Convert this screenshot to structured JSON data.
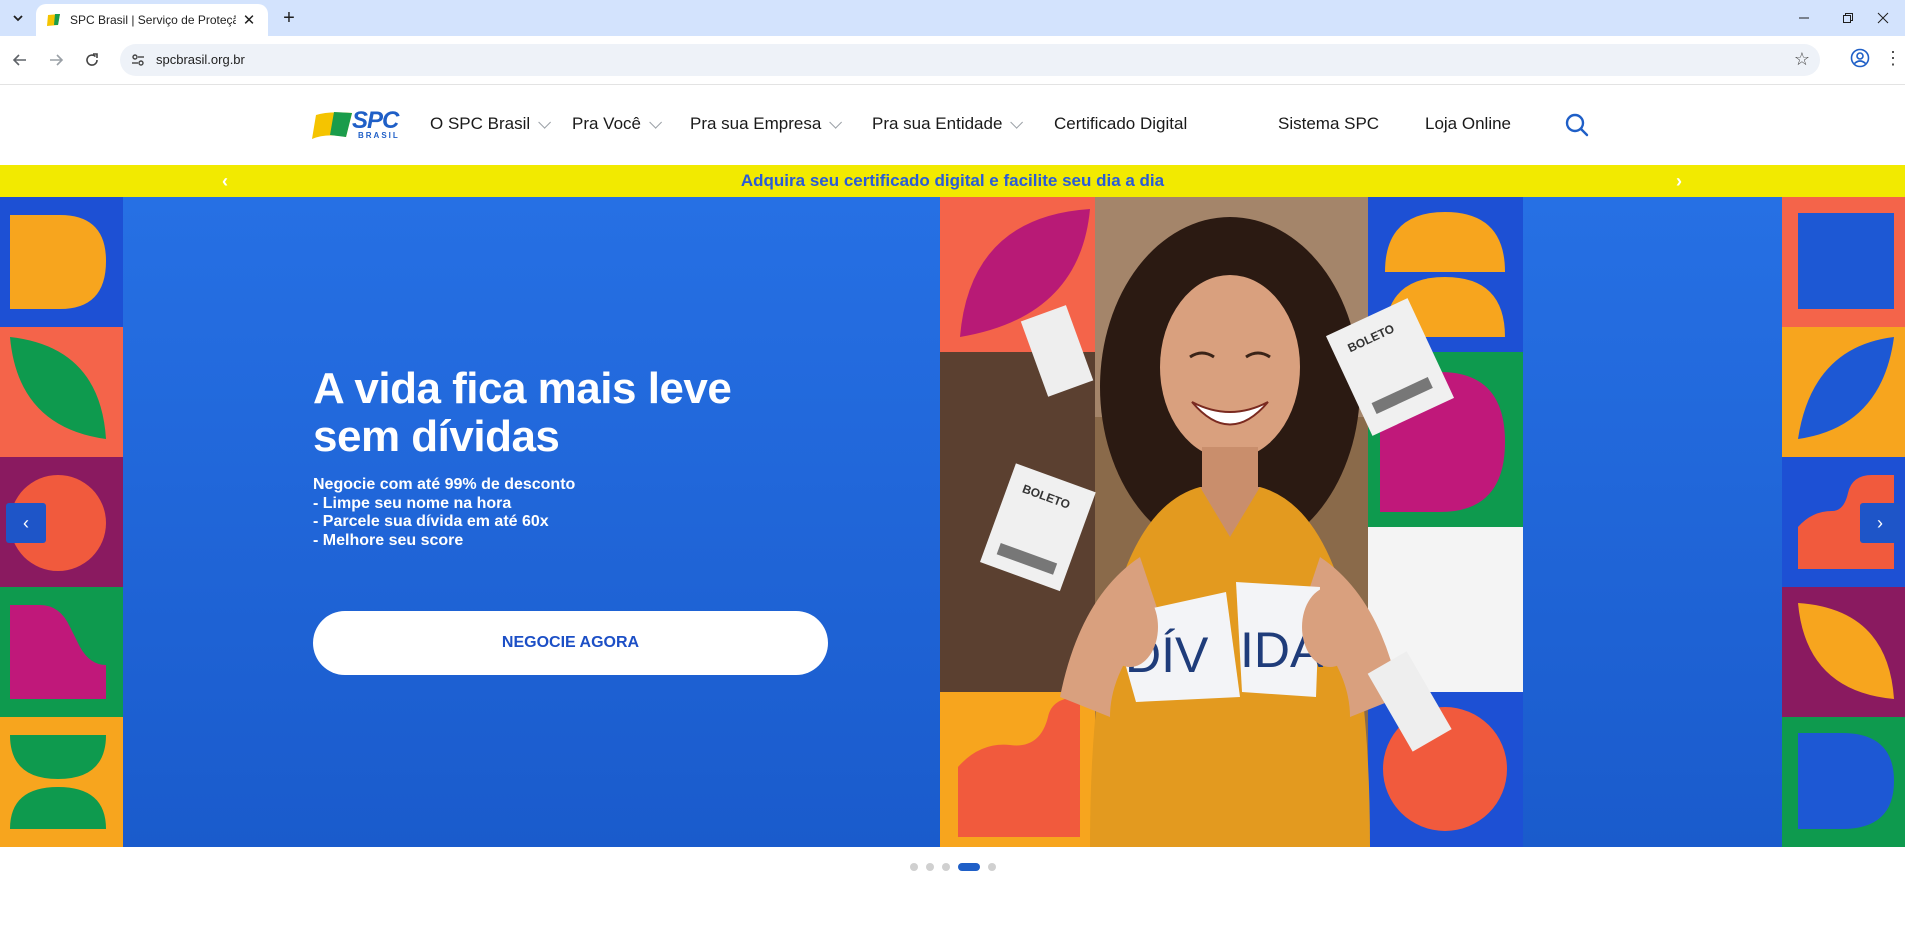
{
  "browser": {
    "tab_title": "SPC Brasil | Serviço de Proteção",
    "url": "spcbrasil.org.br",
    "new_tab": "+",
    "close_tab": "✕"
  },
  "header": {
    "logo_text": "SPC",
    "logo_sub": "BRASIL",
    "menu": [
      {
        "label": "O SPC Brasil",
        "dropdown": true
      },
      {
        "label": "Pra Você",
        "dropdown": true
      },
      {
        "label": "Pra sua Empresa",
        "dropdown": true
      },
      {
        "label": "Pra sua Entidade",
        "dropdown": true
      },
      {
        "label": "Certificado Digital",
        "dropdown": false
      },
      {
        "label": "Sistema SPC",
        "dropdown": false
      },
      {
        "label": "Loja Online",
        "dropdown": false
      }
    ]
  },
  "announcement": {
    "text": "Adquira seu certificado digital e facilite seu dia a dia",
    "prev": "‹",
    "next": "›"
  },
  "hero": {
    "headline_line1": "A vida fica mais leve",
    "headline_line2": "sem dívidas",
    "bullets": [
      "Negocie com até 99% de desconto",
      "- Limpe seu nome na hora",
      "- Parcele sua dívida em até 60x",
      "- Melhore seu score"
    ],
    "cta_label": "NEGOCIE AGORA",
    "paper_left": "DÍV",
    "paper_right": "IDA",
    "receipt_label": "BOLETO",
    "prev": "‹",
    "next": "›"
  },
  "carousel": {
    "slide_count": 5,
    "active_index": 3
  },
  "colors": {
    "brand_blue": "#1f5fc7",
    "hero_blue": "#2266dd",
    "announce_yellow": "#f2ea00"
  }
}
